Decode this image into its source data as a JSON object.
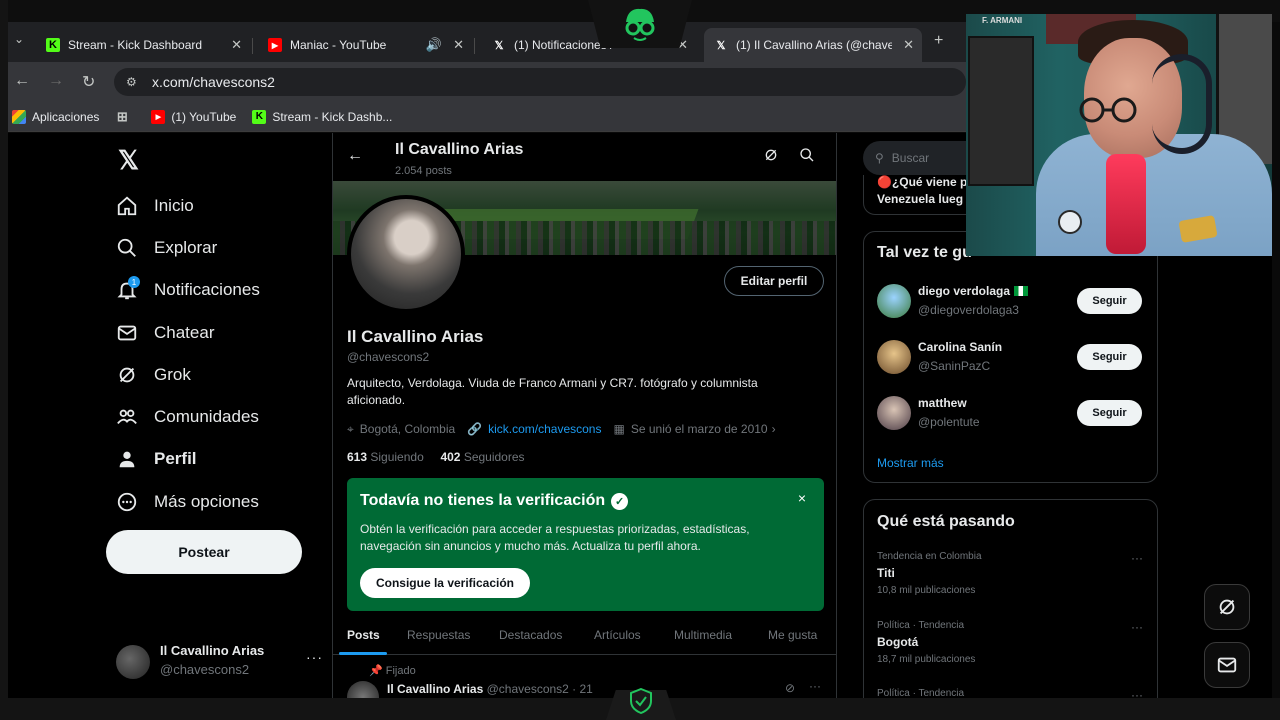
{
  "browser": {
    "tabs": [
      {
        "label": "Stream - Kick Dashboard"
      },
      {
        "label": "Maniac - YouTube"
      },
      {
        "label": "(1) Notificaciones /"
      },
      {
        "label": "(1) Il Cavallino Arias (@chavescons"
      }
    ],
    "new_tab": "+",
    "url": "x.com/chavescons2",
    "bookmarks": [
      {
        "label": "Aplicaciones"
      },
      {
        "label": "(1) YouTube"
      },
      {
        "label": "Stream - Kick Dashb..."
      }
    ]
  },
  "sidebar": {
    "items": [
      {
        "label": "Inicio",
        "icon": "home-icon"
      },
      {
        "label": "Explorar",
        "icon": "search-icon"
      },
      {
        "label": "Notificaciones",
        "icon": "bell-icon",
        "badge": "1"
      },
      {
        "label": "Chatear",
        "icon": "mail-icon"
      },
      {
        "label": "Grok",
        "icon": "grok-icon"
      },
      {
        "label": "Comunidades",
        "icon": "communities-icon"
      },
      {
        "label": "Perfil",
        "icon": "profile-icon"
      },
      {
        "label": "Más opciones",
        "icon": "more-options-icon"
      }
    ],
    "post_button": "Postear",
    "account": {
      "name": "Il Cavallino Arias",
      "handle": "@chavescons2",
      "more": "···"
    }
  },
  "profile": {
    "header_name": "Il Cavallino Arias",
    "header_posts": "2.054 posts",
    "edit_button": "Editar perfil",
    "name": "Il Cavallino Arias",
    "handle": "@chavescons2",
    "bio": "Arquitecto, Verdolaga. Viuda de Franco Armani y CR7. fotógrafo y columnista aficionado.",
    "location": "Bogotá, Colombia",
    "link": "kick.com/chavescons",
    "joined": "Se unió el marzo de 2010",
    "following_count": "613",
    "following_label": "Siguiendo",
    "followers_count": "402",
    "followers_label": "Seguidores",
    "verification": {
      "title": "Todavía no tienes la verificación",
      "text": "Obtén la verificación para acceder a respuestas priorizadas, estadísticas, navegación sin anuncios y mucho más. Actualiza tu perfil ahora.",
      "button": "Consigue la verificación",
      "close": "×"
    },
    "tabs": [
      "Posts",
      "Respuestas",
      "Destacados",
      "Artículos",
      "Multimedia",
      "Me gusta"
    ],
    "pinned_label": "Fijado",
    "tweet_name": "Il Cavallino Arias",
    "tweet_meta": "@chavescons2 · 21"
  },
  "right": {
    "search_placeholder": "Buscar",
    "news_line1": "🔴¿Qué viene p",
    "news_line2": "Venezuela lueg",
    "suggest_title": "Tal vez te gu",
    "suggestions": [
      {
        "name": "diego verdolaga",
        "handle": "@diegoverdolaga3",
        "button": "Seguir"
      },
      {
        "name": "Carolina Sanín",
        "handle": "@SaninPazC",
        "button": "Seguir"
      },
      {
        "name": "matthew",
        "handle": "@polentute",
        "button": "Seguir"
      }
    ],
    "show_more": "Mostrar más",
    "trends_title": "Qué está pasando",
    "trends": [
      {
        "context": "Tendencia en Colombia",
        "name": "Titi",
        "count": "10,8 mil publicaciones"
      },
      {
        "context": "Política · Tendencia",
        "name": "Bogotá",
        "count": "18,7 mil publicaciones"
      },
      {
        "context": "Política · Tendencia",
        "name": "",
        "count": ""
      }
    ]
  },
  "webcam": {
    "wall_label": "F. ARMANI"
  },
  "colors": {
    "accent": "#1d9bf0",
    "verification_bg": "#006a35",
    "background": "#000000"
  }
}
